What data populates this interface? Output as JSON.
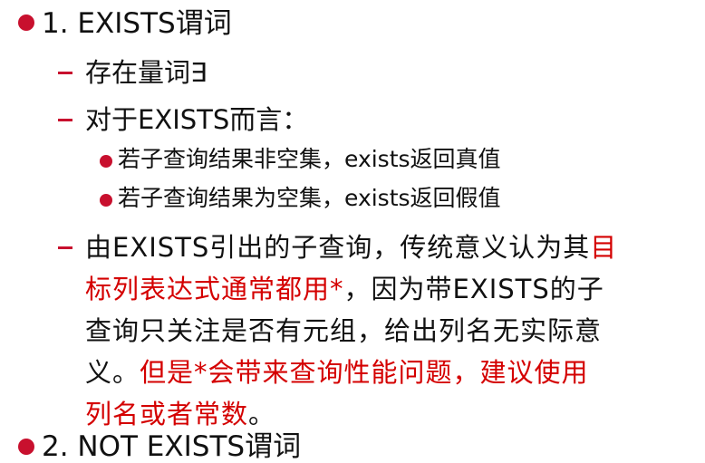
{
  "slide": {
    "items": [
      {
        "level": 1,
        "text": "1. EXISTS谓词"
      },
      {
        "level": 2,
        "text": "存在量词∃"
      },
      {
        "level": 2,
        "text": "对于EXISTS而言："
      },
      {
        "level": 3,
        "text": "若子查询结果非空集，exists返回真值"
      },
      {
        "level": 3,
        "text": "若子查询结果为空集，exists返回假值"
      },
      {
        "level": 2,
        "lines": [
          [
            {
              "text": "由EXISTS引出的子查询，传统意义认为其",
              "color": "black"
            },
            {
              "text": "目",
              "color": "red"
            }
          ],
          [
            {
              "text": "标列表达式通常都用*",
              "color": "red"
            },
            {
              "text": "，因为带EXISTS的子",
              "color": "black"
            }
          ],
          [
            {
              "text": "查询只关注是否有元组，给出列名无实际意",
              "color": "black"
            }
          ],
          [
            {
              "text": "义。",
              "color": "black"
            },
            {
              "text": "但是*会带来查询性能问题，建议使用",
              "color": "red"
            }
          ],
          [
            {
              "text": "列名或者常数",
              "color": "red"
            },
            {
              "text": "。",
              "color": "black"
            }
          ]
        ]
      },
      {
        "level": 1,
        "text": "2. NOT EXISTS谓词"
      }
    ],
    "colors": {
      "bullet": "#c8102e",
      "emphasis": "#d40000",
      "text": "#111111"
    }
  }
}
